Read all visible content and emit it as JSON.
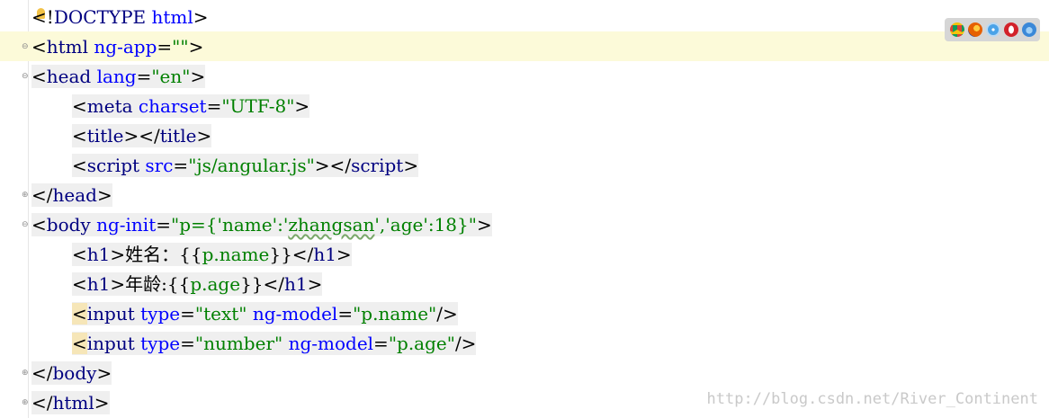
{
  "editor": {
    "lines": [
      {
        "parts": [
          [
            "br",
            "<"
          ],
          [
            "br",
            "!"
          ],
          [
            "tag",
            "DOCTYPE"
          ],
          [
            "br",
            " "
          ],
          [
            "attr",
            "html"
          ],
          [
            "br",
            ">"
          ]
        ]
      },
      {
        "parts": [
          [
            "br",
            "<"
          ],
          [
            "tag",
            "html"
          ],
          [
            "br",
            " "
          ],
          [
            "attr",
            "ng-app"
          ],
          [
            "br",
            "="
          ],
          [
            "str",
            "\"\""
          ],
          [
            "br",
            ">"
          ]
        ]
      },
      {
        "parts": [
          [
            "br",
            "<"
          ],
          [
            "tag",
            "head"
          ],
          [
            "br",
            " "
          ],
          [
            "attr",
            "lang"
          ],
          [
            "br",
            "="
          ],
          [
            "str",
            "\"en\""
          ],
          [
            "br",
            ">"
          ]
        ]
      },
      {
        "parts": [
          [
            "br",
            "<"
          ],
          [
            "tag",
            "meta"
          ],
          [
            "br",
            " "
          ],
          [
            "attr",
            "charset"
          ],
          [
            "br",
            "="
          ],
          [
            "str",
            "\"UTF-8\""
          ],
          [
            "br",
            ">"
          ]
        ]
      },
      {
        "parts": [
          [
            "br",
            "<"
          ],
          [
            "tag",
            "title"
          ],
          [
            "br",
            "></"
          ],
          [
            "tag",
            "title"
          ],
          [
            "br",
            ">"
          ]
        ]
      },
      {
        "parts": [
          [
            "br",
            "<"
          ],
          [
            "tag",
            "script"
          ],
          [
            "br",
            " "
          ],
          [
            "attr",
            "src"
          ],
          [
            "br",
            "="
          ],
          [
            "str",
            "\"js/angular.js\""
          ],
          [
            "br",
            "></"
          ],
          [
            "tag",
            "script"
          ],
          [
            "br",
            ">"
          ]
        ]
      },
      {
        "parts": [
          [
            "br",
            "</"
          ],
          [
            "tag",
            "head"
          ],
          [
            "br",
            ">"
          ]
        ]
      },
      {
        "parts": [
          [
            "br",
            "<"
          ],
          [
            "tag",
            "body"
          ],
          [
            "br",
            " "
          ],
          [
            "attr",
            "ng-init"
          ],
          [
            "br",
            "="
          ],
          [
            "str",
            "\"p={'name':'"
          ],
          [
            "squig",
            "zhangsan"
          ],
          [
            "str",
            "','age':18}\""
          ],
          [
            "br",
            ">"
          ]
        ]
      },
      {
        "parts": [
          [
            "br",
            "<"
          ],
          [
            "tag",
            "h1"
          ],
          [
            "br",
            ">"
          ],
          [
            "br",
            "姓名：{{"
          ],
          [
            "str",
            "p.name"
          ],
          [
            "br",
            "}}</"
          ],
          [
            "tag",
            "h1"
          ],
          [
            "br",
            ">"
          ]
        ]
      },
      {
        "parts": [
          [
            "br",
            "<"
          ],
          [
            "tag",
            "h1"
          ],
          [
            "br",
            ">"
          ],
          [
            "br",
            "年龄:{{"
          ],
          [
            "str",
            "p.age"
          ],
          [
            "br",
            "}}</"
          ],
          [
            "tag",
            "h1"
          ],
          [
            "br",
            ">"
          ]
        ]
      },
      {
        "parts": [
          [
            "hl",
            "<"
          ],
          [
            "tag",
            "input"
          ],
          [
            "br",
            " "
          ],
          [
            "attr",
            "type"
          ],
          [
            "br",
            "="
          ],
          [
            "str",
            "\"text\""
          ],
          [
            "br",
            " "
          ],
          [
            "attr",
            "ng-model"
          ],
          [
            "br",
            "="
          ],
          [
            "str",
            "\"p.name\""
          ],
          [
            "br",
            "/>"
          ]
        ]
      },
      {
        "parts": [
          [
            "hl",
            "<"
          ],
          [
            "tag",
            "input"
          ],
          [
            "br",
            " "
          ],
          [
            "attr",
            "type"
          ],
          [
            "br",
            "="
          ],
          [
            "str",
            "\"number\""
          ],
          [
            "br",
            " "
          ],
          [
            "attr",
            "ng-model"
          ],
          [
            "br",
            "="
          ],
          [
            "str",
            "\"p.age\""
          ],
          [
            "br",
            "/>"
          ]
        ]
      },
      {
        "parts": [
          [
            "br",
            "</"
          ],
          [
            "tag",
            "body"
          ],
          [
            "br",
            ">"
          ]
        ]
      },
      {
        "parts": [
          [
            "br",
            "</"
          ],
          [
            "tag",
            "html"
          ],
          [
            "br",
            ">"
          ]
        ]
      }
    ]
  },
  "browser_icons": [
    {
      "name": "chrome-icon",
      "color": "#e04b3a"
    },
    {
      "name": "firefox-icon",
      "color": "#e07a2a"
    },
    {
      "name": "safari-icon",
      "color": "#3d8fd6"
    },
    {
      "name": "opera-icon",
      "color": "#d2222a"
    },
    {
      "name": "ie-icon",
      "color": "#3a88d8"
    }
  ],
  "watermark": "http://blog.csdn.net/River_Continent"
}
